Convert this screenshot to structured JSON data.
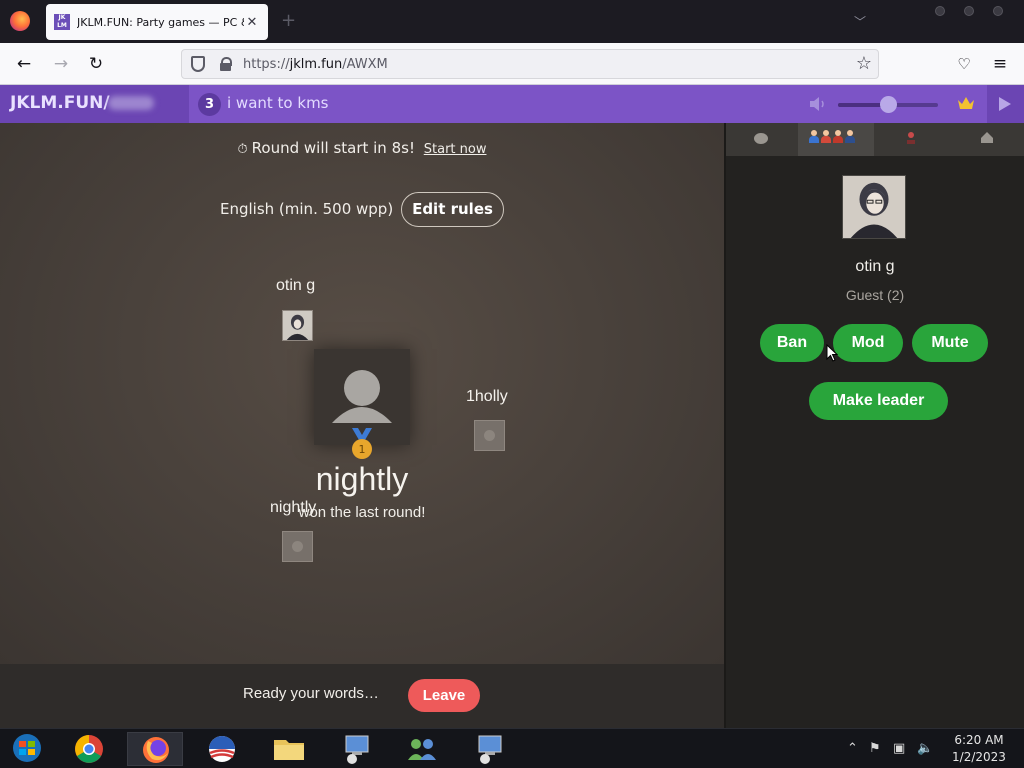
{
  "browser": {
    "tab_title": "JKLM.FUN: Party games — PC & mobile",
    "tab_favicon": "JK LM",
    "url_prefix": "https://",
    "url_domain": "jklm.fun",
    "url_path": "/AWXM"
  },
  "room_bar": {
    "site_name": "JKLM.FUN/",
    "player_count": "3",
    "room_name": "i want to kms"
  },
  "game": {
    "round_message": "Round will start in 8s!",
    "start_now": "Start now",
    "rules": "English (min. 500 wpp)",
    "edit_rules": "Edit rules",
    "players": [
      {
        "name": "otin g"
      },
      {
        "name": "1holly"
      },
      {
        "name": "nightly"
      }
    ],
    "winner_name": "nightly",
    "winner_message": "won the last round!",
    "medal_number": "1",
    "ready_text": "Ready your words…",
    "leave_label": "Leave"
  },
  "sidebar": {
    "profile_name": "otin g",
    "profile_role": "Guest (2)",
    "buttons": {
      "ban": "Ban",
      "mod": "Mod",
      "mute": "Mute",
      "make_leader": "Make leader"
    }
  },
  "taskbar": {
    "time": "6:20 AM",
    "date": "1/2/2023"
  },
  "colors": {
    "accent_purple": "#7c54c6",
    "green_button": "#29a53b",
    "leave_red": "#ee5a5a"
  },
  "volume_level": 0.5
}
